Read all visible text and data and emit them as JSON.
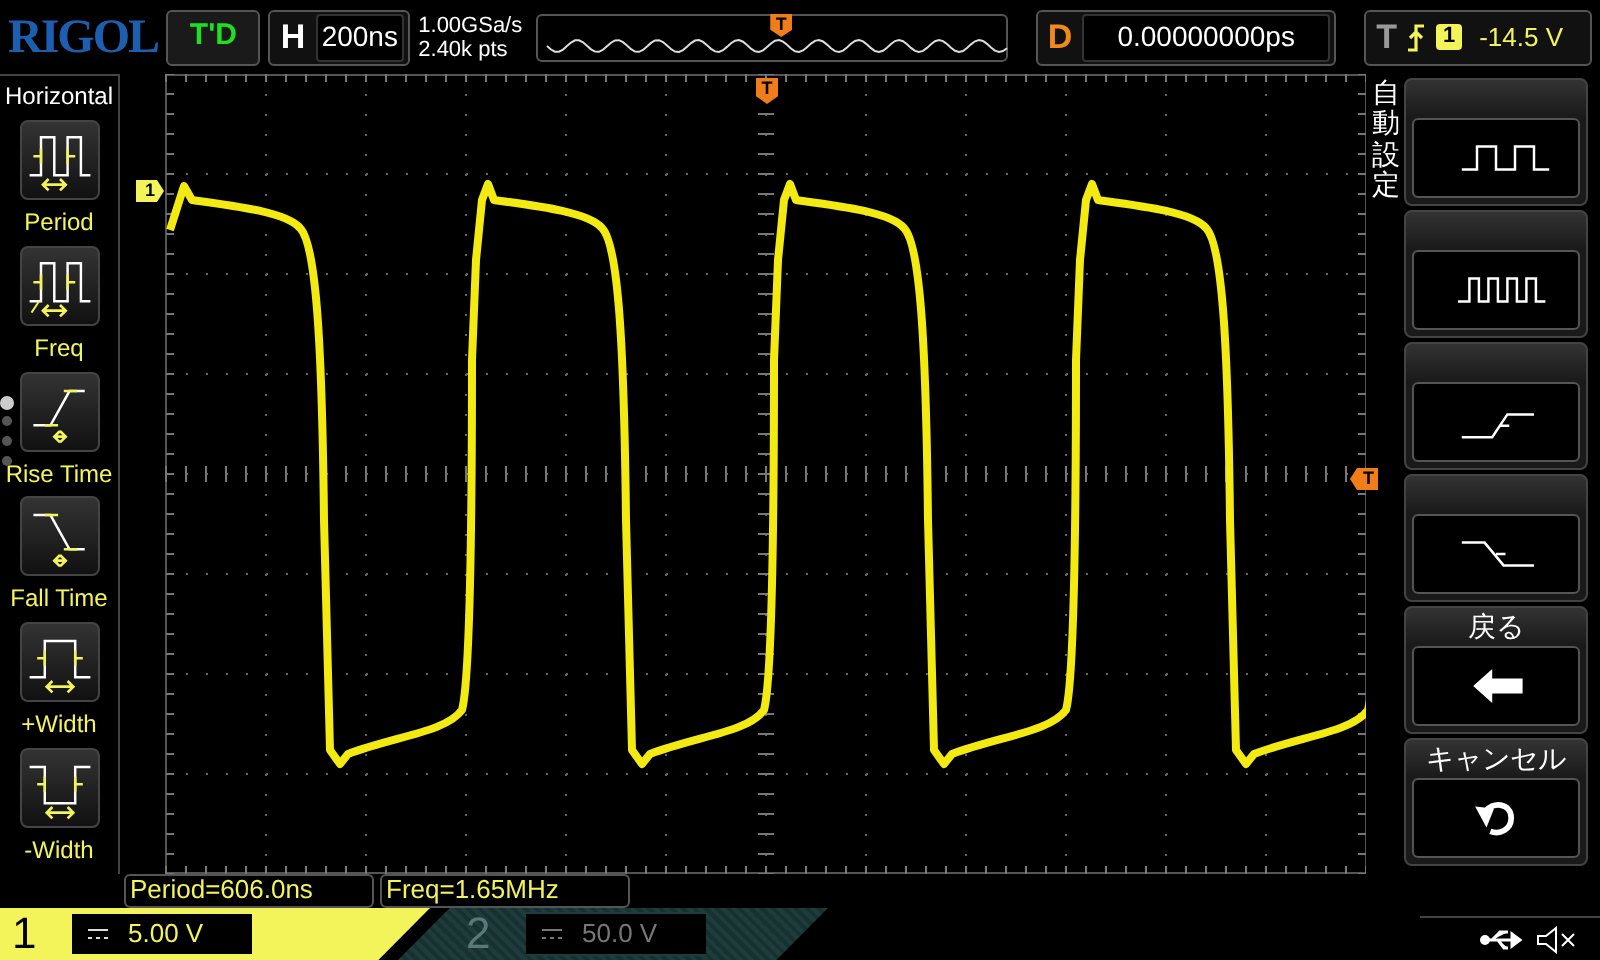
{
  "top_bar": {
    "logo": "RIGOL",
    "run_state": "T'D",
    "timebase": {
      "label": "H",
      "value": "200ns"
    },
    "sample_rate": "1.00GSa/s",
    "memory_depth": "2.40k pts",
    "memory_marker": "T",
    "delay": {
      "label": "D",
      "value": "0.00000000ps"
    },
    "trigger": {
      "label": "T",
      "source": "1",
      "level": "-14.5 V"
    }
  },
  "left_menu": {
    "title": "Horizontal",
    "items": [
      {
        "label": "Period",
        "kind": "period"
      },
      {
        "label": "Freq",
        "kind": "freq"
      },
      {
        "label": "Rise Time",
        "kind": "rise"
      },
      {
        "label": "Fall Time",
        "kind": "fall"
      },
      {
        "label": "+Width",
        "kind": "pwidth"
      },
      {
        "label": "-Width",
        "kind": "nwidth"
      }
    ],
    "pages": [
      {
        "selected": true
      },
      {
        "selected": false
      },
      {
        "selected": false
      },
      {
        "selected": false
      }
    ]
  },
  "graticule": {
    "channel_marker": "1",
    "trigger_marker": "T",
    "time_marker": "T"
  },
  "measurements": [
    "Period=606.0ns",
    "Freq=1.65MHz"
  ],
  "right_menu": {
    "title": "自動設定",
    "buttons": [
      {
        "kind": "square"
      },
      {
        "kind": "pulses"
      },
      {
        "kind": "rise"
      },
      {
        "kind": "fall"
      },
      {
        "label": "戻る",
        "kind": "back"
      },
      {
        "label": "キャンセル",
        "kind": "cancel"
      }
    ]
  },
  "channels": [
    {
      "number": "1",
      "scale": "5.00 V",
      "on": true
    },
    {
      "number": "2",
      "scale": "50.0 V",
      "on": false
    }
  ]
}
